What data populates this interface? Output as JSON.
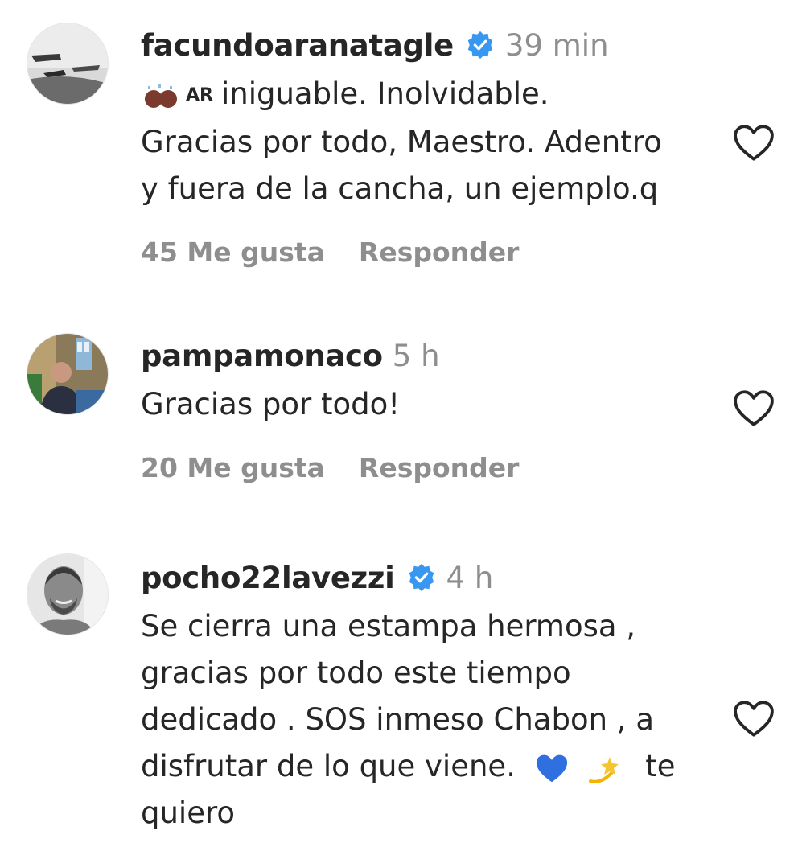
{
  "comments": [
    {
      "username": "facundoaranatagle",
      "verified": true,
      "time": "39 min",
      "flag_label": "AR",
      "lines": [
        "iniguable. Inolvidable.",
        "Gracias por todo, Maestro. Adentro",
        "y fuera de la cancha, un ejemplo.q"
      ],
      "likes": "45 Me gusta",
      "reply": "Responder"
    },
    {
      "username": "pampamonaco",
      "verified": false,
      "time": "5 h",
      "lines": [
        "Gracias por todo!"
      ],
      "likes": "20 Me gusta",
      "reply": "Responder"
    },
    {
      "username": "pocho22lavezzi",
      "verified": true,
      "time": "4 h",
      "lines": [
        "Se cierra una estampa hermosa ,",
        "gracias por todo este tiempo",
        "dedicado . SOS inmeso Chabon , a",
        "disfrutar de lo que viene.",
        "te",
        "quiero"
      ]
    }
  ],
  "icons": {
    "verified": "verified-badge-icon",
    "heart": "heart-outline-icon",
    "blue_heart": "blue-heart-emoji",
    "dizzy": "dizzy-star-emoji",
    "hands": "raising-hands-emoji"
  },
  "colors": {
    "verified_blue": "#3897f0",
    "muted": "#8e8e8e",
    "text": "#262626"
  }
}
